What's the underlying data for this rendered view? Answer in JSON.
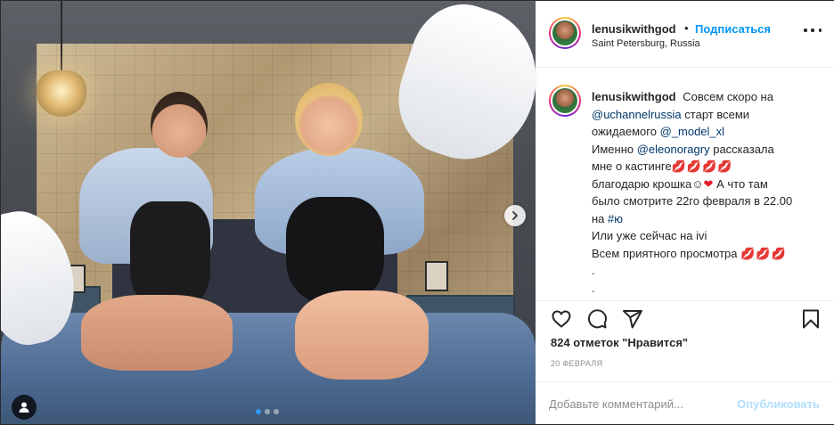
{
  "post": {
    "author": {
      "username": "lenusikwithgod",
      "location": "Saint Petersburg, Russia",
      "follow_label": "Подписаться",
      "separator": "•"
    },
    "caption": {
      "text_1": "Совсем скоро на",
      "mention_1": "@uchannelrussia",
      "text_2": "старт всеми",
      "text_3": "ожидаемого",
      "mention_2": "@_model_xl",
      "text_4": "Именно",
      "mention_3": "@eleonoragry",
      "text_5": "рассказала",
      "text_6": "мне о кастинге",
      "lips_1": "💋💋💋💋",
      "text_7": "благодарю крошка",
      "smile": "☺",
      "heart": "❤",
      "text_8": "А что там",
      "text_9": "было смотрите 22го февраля в 22.00",
      "text_10": "на",
      "hashtag": "#ю",
      "text_11": "Или уже сейчас на ivi",
      "text_12": "Всем приятного просмотра",
      "lips_2": "💋💋💋",
      "dot_1": ".",
      "dot_2": "."
    },
    "likes_text": "824 отметок \"Нравится\"",
    "date": "20 февраля",
    "comment": {
      "placeholder": "Добавьте комментарий...",
      "publish_label": "Опубликовать"
    },
    "carousel": {
      "total_slides": 3,
      "active_slide": 1
    },
    "icons": {
      "like": "heart-icon",
      "comment": "comment-icon",
      "share": "paper-plane-icon",
      "save": "bookmark-icon",
      "more": "more-dots-icon",
      "next": "chevron-right-icon",
      "tag": "user-tag-icon"
    },
    "colors": {
      "link": "#00376b",
      "follow": "#0095f6",
      "publish_disabled": "#b2dffc",
      "muted": "#8e8e8e"
    }
  }
}
